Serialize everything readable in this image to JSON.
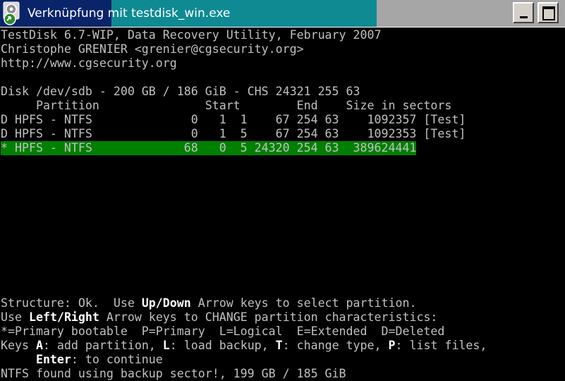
{
  "window": {
    "title": "Verknüpfung mit testdisk_win.exe",
    "icon": "testdisk-app-icon"
  },
  "colors": {
    "titlebar_dark": "#0a246a",
    "titlebar_teal": "#0f8a93",
    "terminal_bg": "#000000",
    "terminal_text": "#c0c0c0",
    "selection_bg": "#008000"
  },
  "header": {
    "line1": "TestDisk 6.7-WIP, Data Recovery Utility, February 2007",
    "line2": "Christophe GRENIER <grenier@cgsecurity.org>",
    "line3": "http://www.cgsecurity.org"
  },
  "disk": {
    "info": "Disk /dev/sdb - 200 GB / 186 GiB - CHS 24321 255 63",
    "columns": "     Partition               Start        End    Size in sectors",
    "rows": [
      "D HPFS - NTFS              0   1  1    67 254 63    1092357 [Test]",
      "D HPFS - NTFS              0   1  5    67 254 63    1092353 [Test]",
      "* HPFS - NTFS             68   0  5 24320 254 63  389624441"
    ]
  },
  "help": {
    "l1_a": "Structure: Ok.  Use ",
    "l1_b": "Up",
    "l1_c": "/",
    "l1_d": "Down",
    "l1_e": " Arrow keys to select partition.",
    "l2_a": "Use ",
    "l2_b": "Left",
    "l2_c": "/",
    "l2_d": "Right",
    "l2_e": " Arrow keys to CHANGE partition characteristics:",
    "l3": "*=Primary bootable  P=Primary  L=Logical  E=Extended  D=Deleted",
    "l4_a": "Keys ",
    "l4_b": "A",
    "l4_c": ": add partition, ",
    "l4_d": "L",
    "l4_e": ": load backup, ",
    "l4_f": "T",
    "l4_g": ": change type, ",
    "l4_h": "P",
    "l4_i": ": list files,",
    "l5_a": "     ",
    "l5_b": "Enter",
    "l5_c": ": to continue",
    "l6": "NTFS found using backup sector!, 199 GB / 185 GiB"
  }
}
